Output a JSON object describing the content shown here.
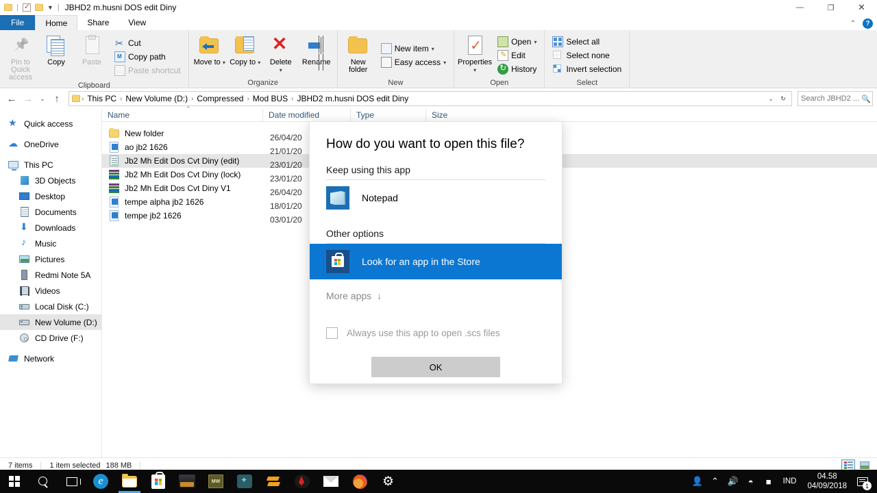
{
  "window": {
    "title": "JBHD2 m.husni DOS edit Diny",
    "minimize": "—",
    "restore": "❐",
    "close": "✕",
    "collapse_ribbon": "⌃",
    "help": "?"
  },
  "tabs": [
    {
      "label": "File",
      "id": "file"
    },
    {
      "label": "Home",
      "id": "home"
    },
    {
      "label": "Share",
      "id": "share"
    },
    {
      "label": "View",
      "id": "view"
    }
  ],
  "ribbon": {
    "groups": [
      {
        "label": "Clipboard",
        "big": [
          {
            "label": "Pin to Quick access",
            "icon": "pin-icon",
            "disabled": true
          },
          {
            "label": "Copy",
            "icon": "copy-icon",
            "disabled": false
          },
          {
            "label": "Paste",
            "icon": "paste-icon",
            "disabled": true
          }
        ],
        "small": [
          {
            "label": "Cut",
            "icon": "cut-icon",
            "disabled": false
          },
          {
            "label": "Copy path",
            "icon": "copy-path-icon",
            "disabled": false
          },
          {
            "label": "Paste shortcut",
            "icon": "paste-shortcut-icon",
            "disabled": true
          }
        ]
      },
      {
        "label": "Organize",
        "big": [
          {
            "label": "Move to",
            "icon": "move-to-icon",
            "caret": "▾"
          },
          {
            "label": "Copy to",
            "icon": "copy-to-icon",
            "caret": "▾"
          },
          {
            "label": "Delete",
            "icon": "delete-icon",
            "caret": "▾"
          },
          {
            "label": "Rename",
            "icon": "rename-icon",
            "caret": ""
          }
        ]
      },
      {
        "label": "New",
        "big": [
          {
            "label": "New folder",
            "icon": "new-folder-icon",
            "caret": ""
          }
        ],
        "small": [
          {
            "label": "New item",
            "icon": "new-item-icon",
            "caret": "▾"
          },
          {
            "label": "Easy access",
            "icon": "easy-access-icon",
            "caret": "▾"
          }
        ]
      },
      {
        "label": "Open",
        "big": [
          {
            "label": "Properties",
            "icon": "properties-icon",
            "caret": "▾"
          }
        ],
        "small": [
          {
            "label": "Open",
            "icon": "open-icon",
            "caret": "▾"
          },
          {
            "label": "Edit",
            "icon": "edit-icon",
            "caret": ""
          },
          {
            "label": "History",
            "icon": "history-icon",
            "caret": ""
          }
        ]
      },
      {
        "label": "Select",
        "small": [
          {
            "label": "Select all",
            "icon": "select-all-icon"
          },
          {
            "label": "Select none",
            "icon": "select-none-icon"
          },
          {
            "label": "Invert selection",
            "icon": "invert-selection-icon"
          }
        ]
      }
    ]
  },
  "address": {
    "back": "←",
    "forward": "→",
    "recent": "⌄",
    "up": "↑",
    "breadcrumbs": [
      "This PC",
      "New Volume (D:)",
      "Compressed",
      "Mod BUS",
      "JBHD2 m.husni DOS edit Diny"
    ],
    "separator": "›",
    "dropdown": "⌄",
    "refresh": "↻"
  },
  "search": {
    "placeholder": "Search JBHD2 ...",
    "value": "",
    "icon": "search-icon"
  },
  "navigation": {
    "items": [
      {
        "label": "Quick access",
        "icon": "star-icon",
        "indent": false,
        "selected": false,
        "gap": false
      },
      {
        "label": "OneDrive",
        "icon": "cloud-icon",
        "indent": false,
        "selected": false,
        "gap": true
      },
      {
        "label": "This PC",
        "icon": "this-pc-icon",
        "indent": false,
        "selected": false,
        "gap": true
      },
      {
        "label": "3D Objects",
        "icon": "3d-objects-icon",
        "indent": true,
        "selected": false,
        "gap": false
      },
      {
        "label": "Desktop",
        "icon": "desktop-icon",
        "indent": true,
        "selected": false,
        "gap": false
      },
      {
        "label": "Documents",
        "icon": "documents-icon",
        "indent": true,
        "selected": false,
        "gap": false
      },
      {
        "label": "Downloads",
        "icon": "downloads-icon",
        "indent": true,
        "selected": false,
        "gap": false
      },
      {
        "label": "Music",
        "icon": "music-icon",
        "indent": true,
        "selected": false,
        "gap": false
      },
      {
        "label": "Pictures",
        "icon": "pictures-icon",
        "indent": true,
        "selected": false,
        "gap": false
      },
      {
        "label": "Redmi Note 5A",
        "icon": "phone-icon",
        "indent": true,
        "selected": false,
        "gap": false
      },
      {
        "label": "Videos",
        "icon": "videos-icon",
        "indent": true,
        "selected": false,
        "gap": false
      },
      {
        "label": "Local Disk (C:)",
        "icon": "drive-icon",
        "indent": true,
        "selected": false,
        "gap": false
      },
      {
        "label": "New Volume (D:)",
        "icon": "drive-icon",
        "indent": true,
        "selected": true,
        "gap": false
      },
      {
        "label": "CD Drive (F:)",
        "icon": "cd-drive-icon",
        "indent": true,
        "selected": false,
        "gap": false
      },
      {
        "label": "Network",
        "icon": "network-icon",
        "indent": false,
        "selected": false,
        "gap": true
      }
    ]
  },
  "file_list": {
    "columns": [
      {
        "label": "Name",
        "key": "name"
      },
      {
        "label": "Date modified",
        "key": "date"
      },
      {
        "label": "Type",
        "key": "type"
      },
      {
        "label": "Size",
        "key": "size"
      }
    ],
    "sort_indicator": "⌃",
    "rows": [
      {
        "name": "New folder",
        "date": "26/04/20",
        "icon": "folder-icon",
        "selected": false
      },
      {
        "name": "ao jb2 1626",
        "date": "21/01/20",
        "icon": "scs-file-icon",
        "selected": false
      },
      {
        "name": "Jb2 Mh Edit Dos Cvt Diny (edit)",
        "date": "23/01/20",
        "icon": "notepad-file-icon",
        "selected": true
      },
      {
        "name": "Jb2 Mh Edit Dos Cvt Diny (lock)",
        "date": "23/01/20",
        "icon": "archive-icon",
        "selected": false
      },
      {
        "name": "Jb2 Mh Edit Dos Cvt Diny V1",
        "date": "26/04/20",
        "icon": "archive-icon",
        "selected": false
      },
      {
        "name": "tempe alpha jb2 1626",
        "date": "18/01/20",
        "icon": "scs-file-icon",
        "selected": false
      },
      {
        "name": "tempe jb2 1626",
        "date": "03/01/20",
        "icon": "scs-file-icon",
        "selected": false
      }
    ]
  },
  "dialog": {
    "title": "How do you want to open this file?",
    "keep_using_label": "Keep using this app",
    "current_app": {
      "name": "Notepad",
      "icon": "notepad-icon"
    },
    "other_options_label": "Other options",
    "store_option": {
      "name": "Look for an app in the Store",
      "icon": "store-icon",
      "selected": true
    },
    "more_apps_label": "More apps",
    "more_apps_arrow": "↓",
    "checkbox_label": "Always use this app to open .scs files",
    "checkbox_checked": false,
    "ok_label": "OK"
  },
  "status_bar": {
    "item_count": "7 items",
    "selection": "1 item selected",
    "size": "188 MB",
    "view_details": "details-view-icon",
    "view_large": "large-icons-view-icon"
  },
  "taskbar": {
    "items": [
      {
        "name": "start-button",
        "icon": "windows-logo-icon"
      },
      {
        "name": "search-button",
        "icon": "search-icon"
      },
      {
        "name": "task-view-button",
        "icon": "task-view-icon"
      },
      {
        "name": "edge-button",
        "icon": "edge-icon",
        "glyph": "e"
      },
      {
        "name": "file-explorer-button",
        "icon": "file-explorer-icon",
        "active": true
      },
      {
        "name": "store-button",
        "icon": "store-icon"
      },
      {
        "name": "ets2-button",
        "icon": "truck-icon"
      },
      {
        "name": "mw-button",
        "icon": "mw-icon",
        "glyph": "MW"
      },
      {
        "name": "teal-app-button",
        "icon": "teal-app-icon"
      },
      {
        "name": "winrar-button",
        "icon": "winrar-icon"
      },
      {
        "name": "red-app-button",
        "icon": "red-app-icon"
      },
      {
        "name": "mail-button",
        "icon": "mail-icon"
      },
      {
        "name": "firefox-button",
        "icon": "firefox-icon"
      },
      {
        "name": "settings-button",
        "icon": "gear-icon"
      }
    ],
    "tray": {
      "people": "👤",
      "chevron": "⌃",
      "volume": "🔊",
      "wifi": "📶",
      "battery": "🔋",
      "language": "IND",
      "time": "04.58",
      "date": "04/09/2018",
      "notification_count": "1"
    }
  }
}
